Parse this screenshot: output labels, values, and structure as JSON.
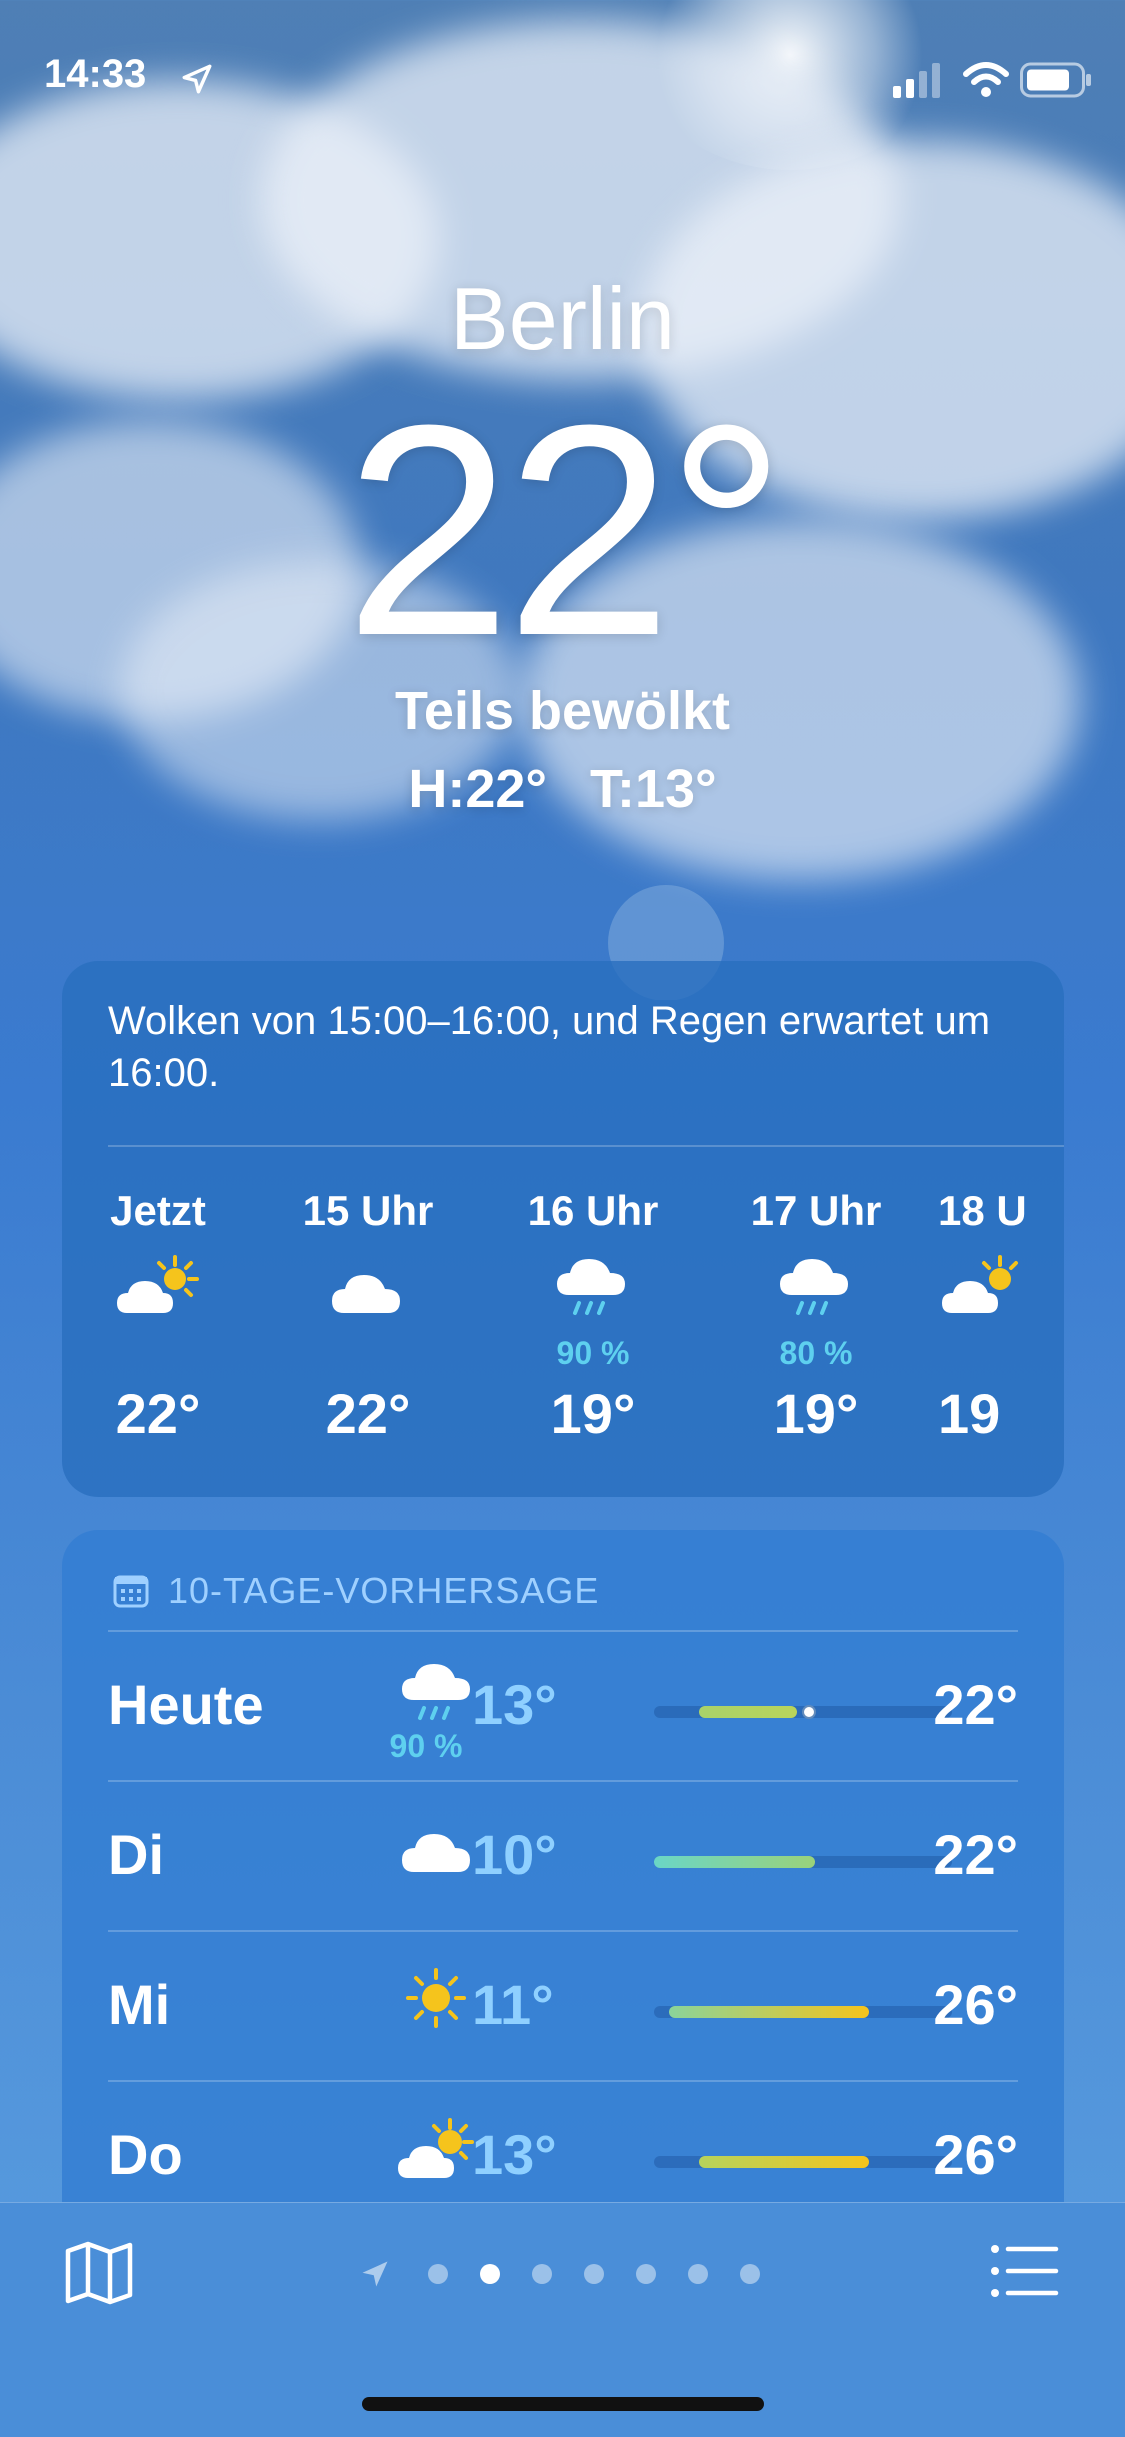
{
  "status_bar": {
    "time": "14:33"
  },
  "header": {
    "city": "Berlin",
    "temperature": "22°",
    "condition": "Teils bewölkt",
    "high": "H:22°",
    "low": "T:13°"
  },
  "hourly": {
    "summary": "Wolken von 15:00–16:00, und Regen erwartet um 16:00.",
    "hours": [
      {
        "label": "Jetzt",
        "icon": "partly-cloudy-icon",
        "precip": "",
        "temp": "22°"
      },
      {
        "label": "15 Uhr",
        "icon": "cloud-icon",
        "precip": "",
        "temp": "22°"
      },
      {
        "label": "16 Uhr",
        "icon": "rain-cloud-icon",
        "precip": "90 %",
        "temp": "19°"
      },
      {
        "label": "17 Uhr",
        "icon": "rain-cloud-icon",
        "precip": "80 %",
        "temp": "19°"
      },
      {
        "label": "18 U",
        "icon": "partly-cloudy-icon",
        "precip": "",
        "temp": "19"
      }
    ]
  },
  "daily": {
    "title": "10-TAGE-VORHERSAGE",
    "days": [
      {
        "day": "Heute",
        "icon": "rain-cloud-icon",
        "precip": "90 %",
        "low": "13°",
        "high": "22°",
        "range_start": 0.15,
        "range_end": 0.48,
        "current": 0.52,
        "color_from": "#a9d26a",
        "color_to": "#b9d45a"
      },
      {
        "day": "Di",
        "icon": "cloud-icon",
        "precip": "",
        "low": "10°",
        "high": "22°",
        "range_start": 0.0,
        "range_end": 0.54,
        "color_from": "#6ad6c6",
        "color_to": "#9ad27a"
      },
      {
        "day": "Mi",
        "icon": "sun-icon",
        "precip": "",
        "low": "11°",
        "high": "26°",
        "range_start": 0.05,
        "range_end": 0.72,
        "color_from": "#8ad49a",
        "color_to": "#f5c41c"
      },
      {
        "day": "Do",
        "icon": "partly-cloudy-icon",
        "precip": "",
        "low": "13°",
        "high": "26°",
        "range_start": 0.15,
        "range_end": 0.72,
        "color_from": "#b6d35c",
        "color_to": "#f5c41c"
      }
    ]
  },
  "pager": {
    "count": 7,
    "active": 0
  },
  "colors": {
    "accent_precip": "#5ed0ef",
    "sun": "#f5c41c"
  }
}
